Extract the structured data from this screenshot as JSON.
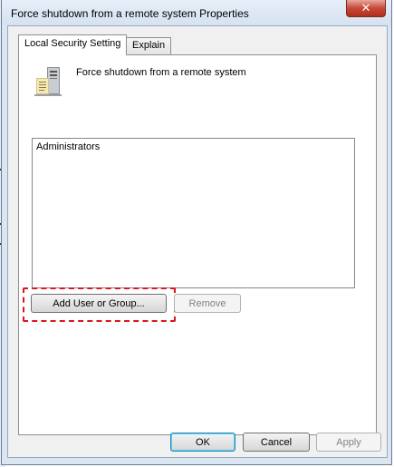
{
  "window": {
    "title": "Force shutdown from a remote system Properties",
    "close_glyph": "✕"
  },
  "tabs": [
    {
      "label": "Local Security Setting",
      "active": true
    },
    {
      "label": "Explain",
      "active": false
    }
  ],
  "policy": {
    "icon": "server-computer-icon",
    "name": "Force shutdown from a remote system"
  },
  "members": [
    "Administrators"
  ],
  "actions": {
    "add_label": "Add User or Group...",
    "remove_label": "Remove"
  },
  "footer": {
    "ok_label": "OK",
    "cancel_label": "Cancel",
    "apply_label": "Apply"
  },
  "colors": {
    "highlight": "#d9171c",
    "close_button": "#c74836"
  }
}
